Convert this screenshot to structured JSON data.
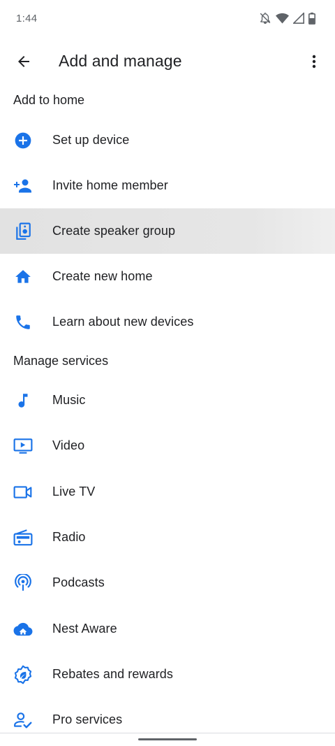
{
  "status_bar": {
    "time": "1:44",
    "icons": [
      "notifications-off-icon",
      "wifi-icon",
      "cell-signal-icon",
      "battery-icon"
    ]
  },
  "app_bar": {
    "title": "Add and manage",
    "back_icon": "arrow-back-icon",
    "more_icon": "more-vert-icon"
  },
  "sections": {
    "add_to_home": {
      "title": "Add to home",
      "items": [
        {
          "label": "Set up device",
          "icon": "add-circle-icon"
        },
        {
          "label": "Invite home member",
          "icon": "person-add-icon"
        },
        {
          "label": "Create speaker group",
          "icon": "speaker-group-icon"
        },
        {
          "label": "Create new home",
          "icon": "home-icon"
        },
        {
          "label": "Learn about new devices",
          "icon": "phone-icon"
        }
      ]
    },
    "manage_services": {
      "title": "Manage services",
      "items": [
        {
          "label": "Music",
          "icon": "music-note-icon"
        },
        {
          "label": "Video",
          "icon": "video-icon"
        },
        {
          "label": "Live TV",
          "icon": "videocam-icon"
        },
        {
          "label": "Radio",
          "icon": "radio-icon"
        },
        {
          "label": "Podcasts",
          "icon": "podcasts-icon"
        },
        {
          "label": "Nest Aware",
          "icon": "cloud-home-icon"
        },
        {
          "label": "Rebates and rewards",
          "icon": "rewards-badge-icon"
        },
        {
          "label": "Pro services",
          "icon": "pro-services-icon"
        }
      ]
    }
  },
  "colors": {
    "accent": "#1a73e8",
    "text": "#202124",
    "secondary_text": "#5f6368",
    "highlight": "#e4e4e4"
  }
}
